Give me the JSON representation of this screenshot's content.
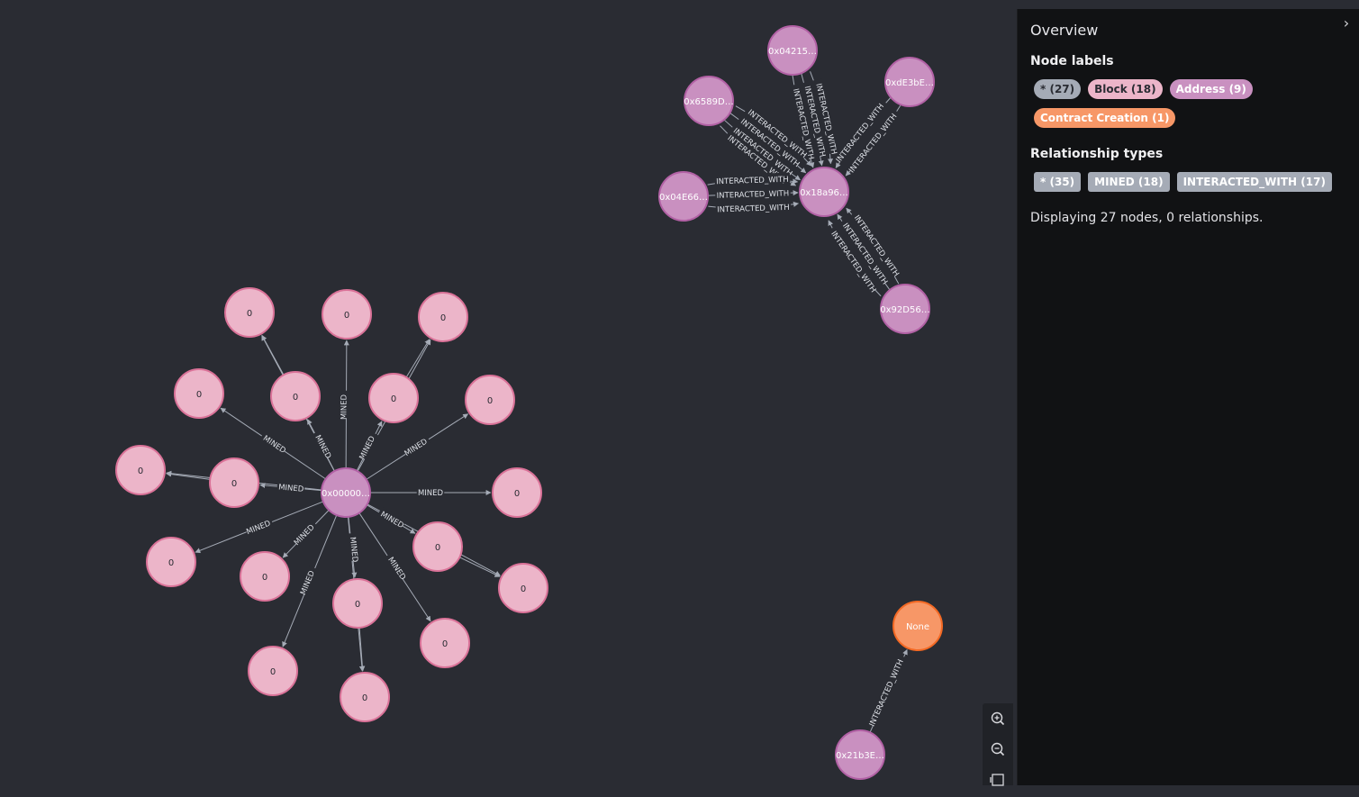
{
  "overview": {
    "title": "Overview",
    "node_labels_title": "Node labels",
    "relationship_types_title": "Relationship types",
    "summary": "Displaying 27 nodes, 0 relationships."
  },
  "node_label_chips": [
    {
      "label": "* (27)",
      "bg": "#a5abb6",
      "fg": "#2a2c33"
    },
    {
      "label": "Block (18)",
      "bg": "#ecb5c9",
      "fg": "#2a2c33"
    },
    {
      "label": "Address (9)",
      "bg": "#c990c0",
      "fg": "#ffffff"
    },
    {
      "label": "Contract Creation (1)",
      "bg": "#f79767",
      "fg": "#ffffff"
    }
  ],
  "relationship_chips": [
    {
      "label": "* (35)",
      "bg": "#a5abb6",
      "fg": "#ffffff"
    },
    {
      "label": "MINED (18)",
      "bg": "#a5abb6",
      "fg": "#ffffff"
    },
    {
      "label": "INTERACTED_WITH (17)",
      "bg": "#a5abb6",
      "fg": "#ffffff"
    }
  ],
  "colors": {
    "canvas_bg": "#2a2c33",
    "block": "#ecb5c9",
    "block_border": "#da7298",
    "address": "#c990c0",
    "address_border": "#b261a5",
    "contract": "#f79767",
    "contract_border": "#f36924",
    "edge": "#a5abb6"
  },
  "graph": {
    "rel_mined": "MINED",
    "rel_interacted": "INTERACTED_WITH",
    "miner": "0x00000…",
    "hub": "0x18a96…",
    "addresses": [
      "0x04215…",
      "0xdE3bE…",
      "0x6589D…",
      "0x04E66…",
      "0x92D56…",
      "0x21b3E…"
    ],
    "block_label": "0",
    "contract_label": "None"
  },
  "zoom": {
    "in_icon": "zoom-in-icon",
    "out_icon": "zoom-out-icon",
    "fit_icon": "fit-screen-icon"
  }
}
